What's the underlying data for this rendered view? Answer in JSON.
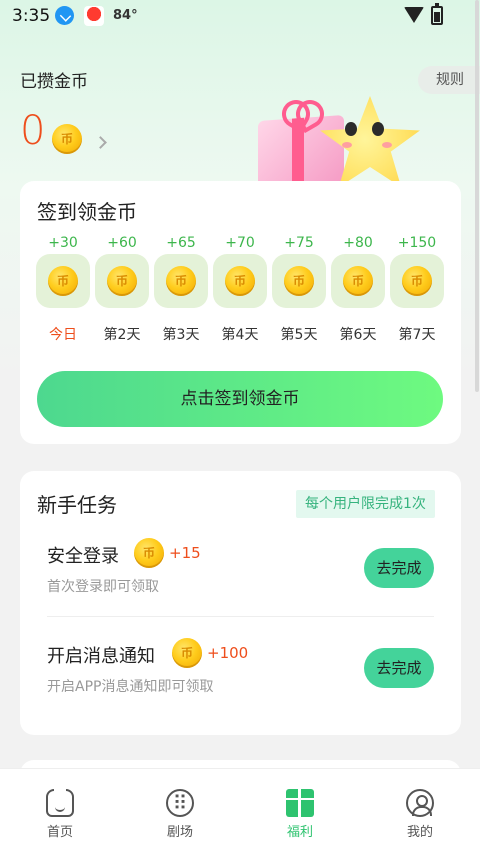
{
  "status_bar": {
    "time": "3:35",
    "temperature": "84°"
  },
  "header": {
    "coins_label": "已攒金币",
    "coin_count": "0",
    "rules_label": "规则"
  },
  "checkin": {
    "title": "签到领金币",
    "days": [
      {
        "reward": "+30",
        "label": "今日",
        "today": true
      },
      {
        "reward": "+60",
        "label": "第2天"
      },
      {
        "reward": "+65",
        "label": "第3天"
      },
      {
        "reward": "+70",
        "label": "第4天"
      },
      {
        "reward": "+75",
        "label": "第5天"
      },
      {
        "reward": "+80",
        "label": "第6天"
      },
      {
        "reward": "+150",
        "label": "第7天"
      }
    ],
    "button_label": "点击签到领金币"
  },
  "tasks": {
    "title": "新手任务",
    "limit_badge": "每个用户限完成1次",
    "items": [
      {
        "title": "安全登录",
        "reward": "+15",
        "desc": "首次登录即可领取",
        "button": "去完成"
      },
      {
        "title": "开启消息通知",
        "reward": "+100",
        "desc": "开启APP消息通知即可领取",
        "button": "去完成"
      }
    ]
  },
  "nav": {
    "items": [
      {
        "label": "首页",
        "icon": "home-icon"
      },
      {
        "label": "剧场",
        "icon": "theater-icon"
      },
      {
        "label": "福利",
        "icon": "gift-icon",
        "active": true
      },
      {
        "label": "我的",
        "icon": "profile-icon"
      }
    ]
  },
  "colors": {
    "accent_green": "#2ec36f",
    "coin_orange": "#ee4e1c",
    "button_green": "#44d39a"
  }
}
